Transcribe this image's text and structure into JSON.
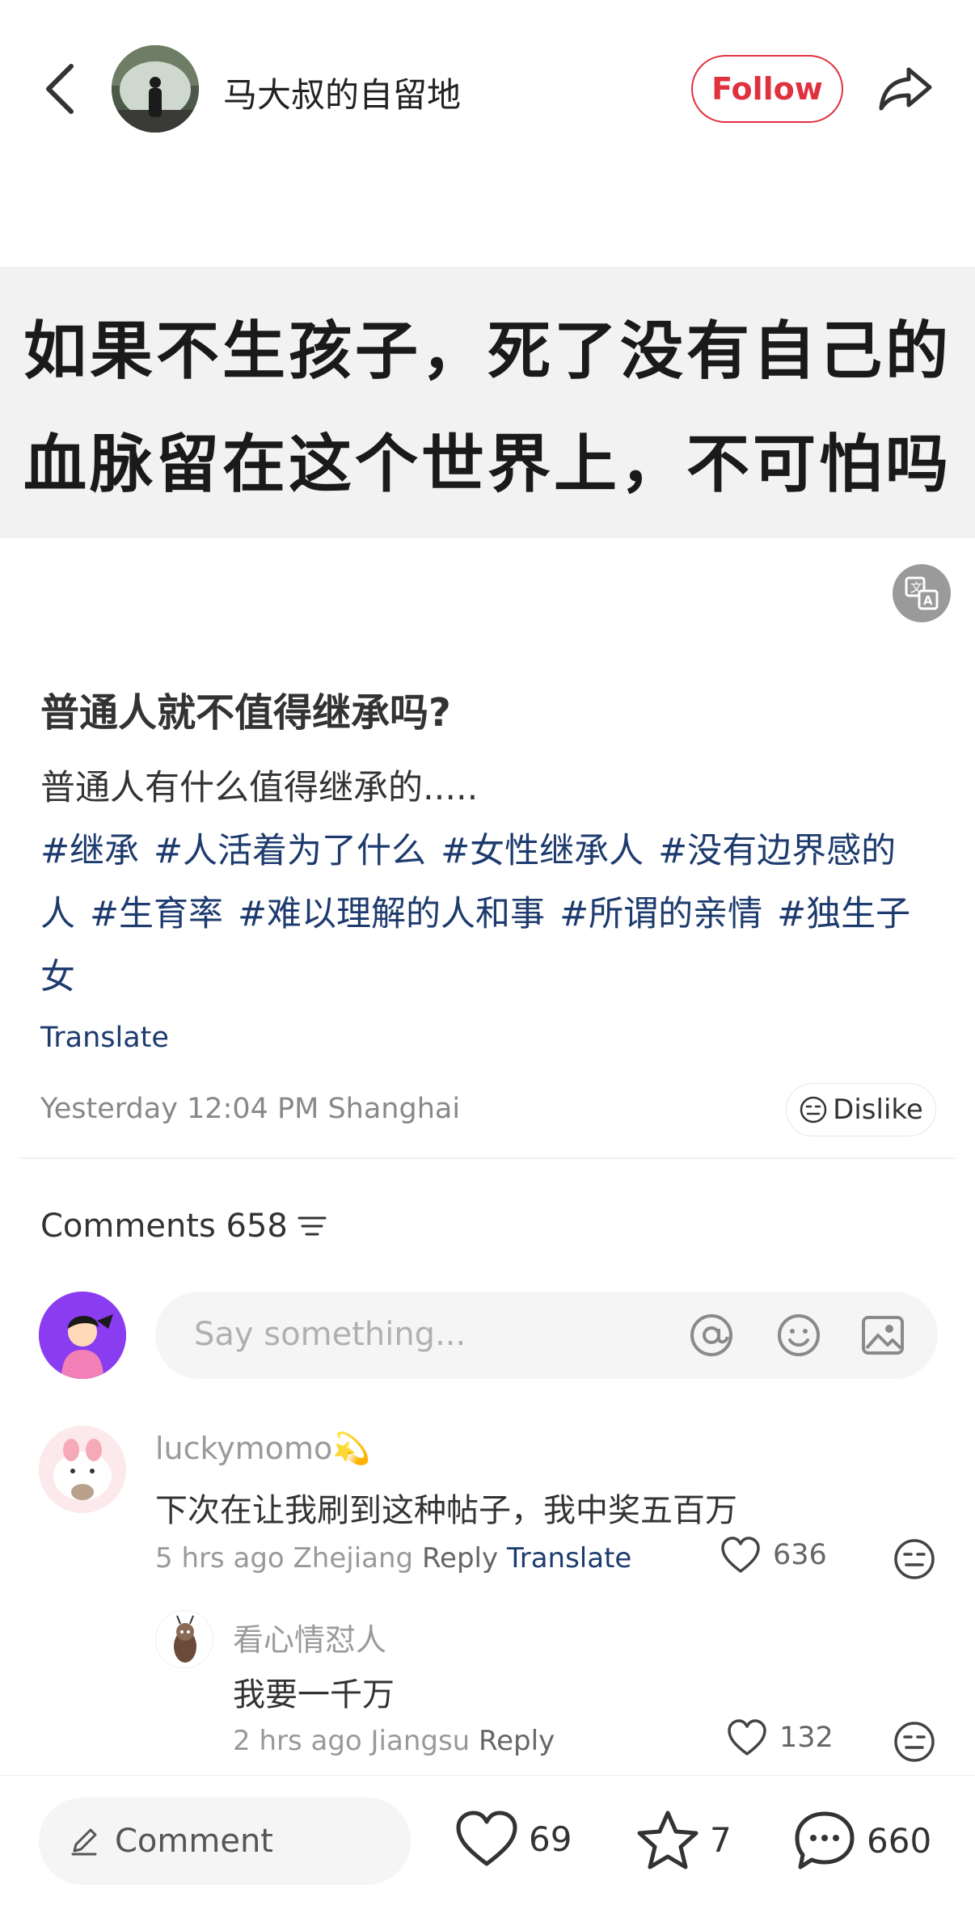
{
  "header": {
    "author_name": "马大叔的自留地",
    "follow_label": "Follow"
  },
  "post_image": {
    "line1": "如果不生孩子，死了没有自己的",
    "line2": "血脉留在这个世界上，不可怕吗"
  },
  "post": {
    "title": "普通人就不值得继承吗?",
    "body": "普通人有什么值得继承的.....",
    "tags": [
      "#继承",
      "#人活着为了什么",
      "#女性继承人",
      "#没有边界感的人",
      "#生育率",
      "#难以理解的人和事",
      "#所谓的亲情",
      "#独生子女"
    ],
    "translate_label": "Translate",
    "meta": "Yesterday 12:04 PM Shanghai",
    "dislike_label": "Dislike"
  },
  "comments_section": {
    "header": "Comments 658",
    "input_placeholder": "Say something..."
  },
  "comments": [
    {
      "user": "luckymomo💫",
      "text": "下次在让我刷到这种帖子，我中奖五百万",
      "time_location": "5 hrs ago Zhejiang",
      "reply_label": "Reply",
      "translate_label": "Translate",
      "likes": "636"
    },
    {
      "user": "看心情怼人",
      "text": "我要一千万",
      "time_location": "2 hrs ago Jiangsu",
      "reply_label": "Reply",
      "likes": "132"
    }
  ],
  "bottom_bar": {
    "comment_label": "Comment",
    "likes": "69",
    "collects": "7",
    "comments": "660"
  },
  "colors": {
    "accent_red": "#e0313f",
    "link_blue": "#1d3b6e"
  },
  "icons": [
    "chevron-left-icon",
    "share-icon",
    "translate-icon",
    "neutral-face-icon",
    "filter-icon",
    "at-icon",
    "smile-icon",
    "image-icon",
    "heart-icon",
    "pencil-icon",
    "star-icon",
    "chat-bubble-icon"
  ]
}
